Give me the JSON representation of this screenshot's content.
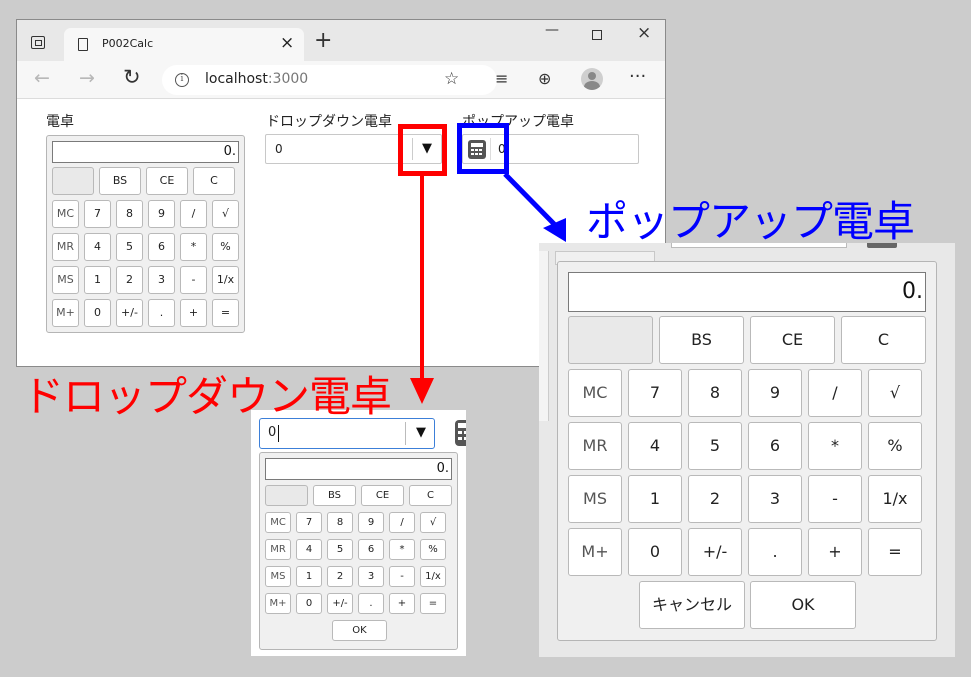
{
  "browser": {
    "tab_title": "P002Calc",
    "tab_close": "×",
    "new_tab": "+",
    "window_minimize": "—",
    "window_close": "×",
    "nav_back": "←",
    "nav_forward": "→",
    "nav_refresh": "↻",
    "info": "i",
    "url_host": "localhost",
    "url_port": ":3000",
    "favorite": "☆",
    "collections": "≡",
    "extensions": "⊕",
    "more": "···"
  },
  "page": {
    "calc_label": "電卓",
    "dropdown_label": "ドロップダウン電卓",
    "popup_label": "ポップアップ電卓",
    "dropdown_value": "0",
    "dropdown_arrow": "▼",
    "popup_value": "0"
  },
  "calculator": {
    "display": "0.",
    "top_row": [
      "",
      "BS",
      "CE",
      "C"
    ],
    "rows": [
      [
        "MC",
        "7",
        "8",
        "9",
        "/",
        "√"
      ],
      [
        "MR",
        "4",
        "5",
        "6",
        "*",
        "%"
      ],
      [
        "MS",
        "1",
        "2",
        "3",
        "-",
        "1/x"
      ],
      [
        "M+",
        "0",
        "+/-",
        ".",
        "+",
        "="
      ]
    ]
  },
  "annotations": {
    "dropdown_title": "ドロップダウン電卓",
    "popup_title": "ポップアップ電卓",
    "color_red": "#ff0000",
    "color_blue": "#0000ff"
  },
  "dropdown_panel": {
    "input_value": "0",
    "arrow": "▼",
    "display": "0.",
    "ok_label": "OK"
  },
  "popup_panel": {
    "display": "0.",
    "cancel_label": "キャンセル",
    "ok_label": "OK"
  }
}
